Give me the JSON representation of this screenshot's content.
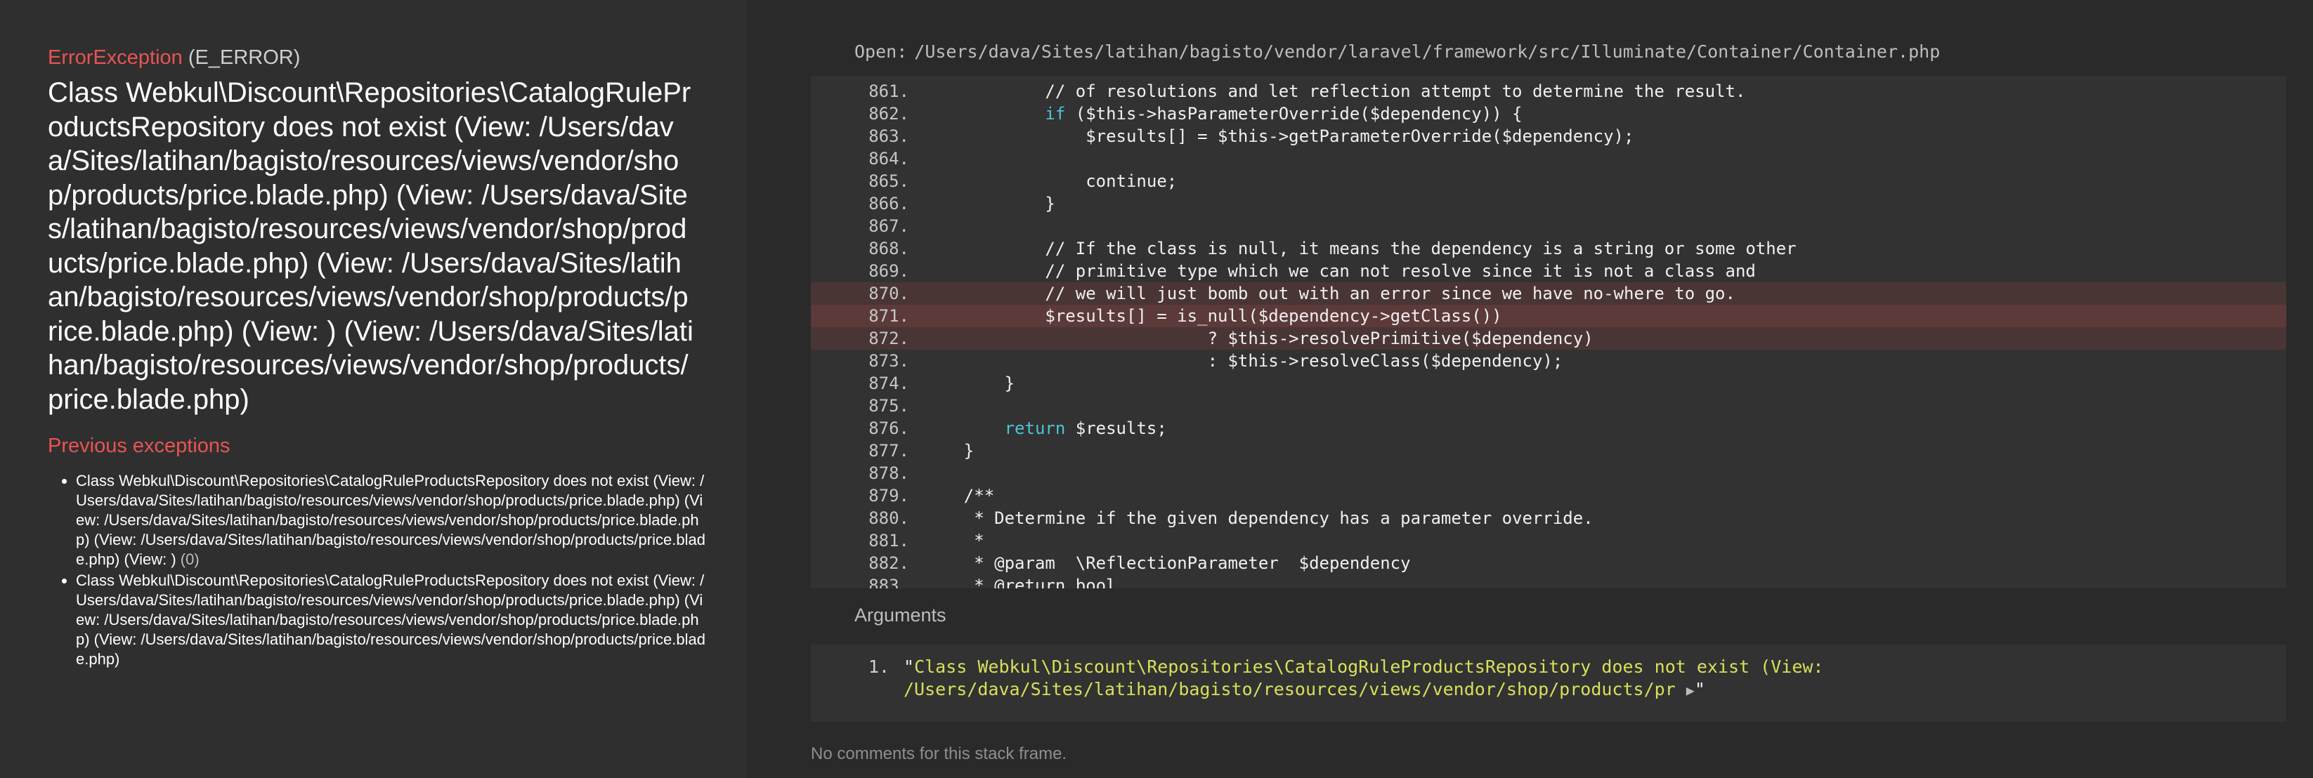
{
  "exception": {
    "name": "ErrorException",
    "code": "(E_ERROR)",
    "message": "Class Webkul\\Discount\\Repositories\\CatalogRuleProductsRepository does not exist (View: /Users/dava/Sites/latihan/bagisto/resources/views/vendor/shop/products/price.blade.php) (View: /Users/dava/Sites/latihan/bagisto/resources/views/vendor/shop/products/price.blade.php) (View: /Users/dava/Sites/latihan/bagisto/resources/views/vendor/shop/products/price.blade.php) (View: ) (View: /Users/dava/Sites/latihan/bagisto/resources/views/vendor/shop/products/price.blade.php)"
  },
  "previous": {
    "title": "Previous exceptions",
    "items": [
      {
        "text": "Class Webkul\\Discount\\Repositories\\CatalogRuleProductsRepository does not exist (View: /Users/dava/Sites/latihan/bagisto/resources/views/vendor/shop/products/price.blade.php) (View: /Users/dava/Sites/latihan/bagisto/resources/views/vendor/shop/products/price.blade.php) (View: /Users/dava/Sites/latihan/bagisto/resources/views/vendor/shop/products/price.blade.php) (View: )",
        "index": "(0)"
      },
      {
        "text": "Class Webkul\\Discount\\Repositories\\CatalogRuleProductsRepository does not exist (View: /Users/dava/Sites/latihan/bagisto/resources/views/vendor/shop/products/price.blade.php) (View: /Users/dava/Sites/latihan/bagisto/resources/views/vendor/shop/products/price.blade.php) (View: /Users/dava/Sites/latihan/bagisto/resources/views/vendor/shop/products/price.blade.php)",
        "index": ""
      }
    ]
  },
  "frame": {
    "open_label": "Open:",
    "file_path": "/Users/dava/Sites/latihan/bagisto/vendor/laravel/framework/src/Illuminate/Container/Container.php",
    "code_lines": [
      {
        "num": "861.",
        "text": "            // of resolutions and let reflection attempt to determine the result.",
        "kind": "comment",
        "hl": ""
      },
      {
        "num": "862.",
        "text": "            if ($this->hasParameterOverride($dependency)) {",
        "kind": "if",
        "hl": ""
      },
      {
        "num": "863.",
        "text": "                $results[] = $this->getParameterOverride($dependency);",
        "kind": "code",
        "hl": ""
      },
      {
        "num": "864.",
        "text": "",
        "kind": "code",
        "hl": ""
      },
      {
        "num": "865.",
        "text": "                continue;",
        "kind": "kw",
        "hl": ""
      },
      {
        "num": "866.",
        "text": "            }",
        "kind": "code",
        "hl": ""
      },
      {
        "num": "867.",
        "text": "",
        "kind": "code",
        "hl": ""
      },
      {
        "num": "868.",
        "text": "            // If the class is null, it means the dependency is a string or some other",
        "kind": "comment",
        "hl": ""
      },
      {
        "num": "869.",
        "text": "            // primitive type which we can not resolve since it is not a class and",
        "kind": "comment",
        "hl": ""
      },
      {
        "num": "870.",
        "text": "            // we will just bomb out with an error since we have no-where to go.",
        "kind": "comment",
        "hl": "soft"
      },
      {
        "num": "871.",
        "text": "            $results[] = is_null($dependency->getClass())",
        "kind": "code",
        "hl": "strong"
      },
      {
        "num": "872.",
        "text": "                            ? $this->resolvePrimitive($dependency)",
        "kind": "code",
        "hl": "soft"
      },
      {
        "num": "873.",
        "text": "                            : $this->resolveClass($dependency);",
        "kind": "code",
        "hl": ""
      },
      {
        "num": "874.",
        "text": "        }",
        "kind": "code",
        "hl": ""
      },
      {
        "num": "875.",
        "text": "",
        "kind": "code",
        "hl": ""
      },
      {
        "num": "876.",
        "text": "        return $results;",
        "kind": "return",
        "hl": ""
      },
      {
        "num": "877.",
        "text": "    }",
        "kind": "code",
        "hl": ""
      },
      {
        "num": "878.",
        "text": "",
        "kind": "code",
        "hl": ""
      },
      {
        "num": "879.",
        "text": "    /**",
        "kind": "comment",
        "hl": ""
      },
      {
        "num": "880.",
        "text": "     * Determine if the given dependency has a parameter override.",
        "kind": "comment",
        "hl": ""
      },
      {
        "num": "881.",
        "text": "     *",
        "kind": "comment",
        "hl": ""
      },
      {
        "num": "882.",
        "text": "     * @param  \\ReflectionParameter  $dependency",
        "kind": "comment",
        "hl": ""
      },
      {
        "num": "883.",
        "text": "     * @return bool",
        "kind": "comment",
        "hl": ""
      }
    ]
  },
  "arguments": {
    "title": "Arguments",
    "items": [
      {
        "num": "1.",
        "open_quote": "\"",
        "value": "Class Webkul\\Discount\\Repositories\\CatalogRuleProductsRepository does not exist (View:\n/Users/dava/Sites/latihan/bagisto/resources/views/vendor/shop/products/pr ",
        "expand": "▶",
        "close_quote": "\""
      }
    ]
  },
  "comments": {
    "empty_text": "No comments for this stack frame."
  }
}
